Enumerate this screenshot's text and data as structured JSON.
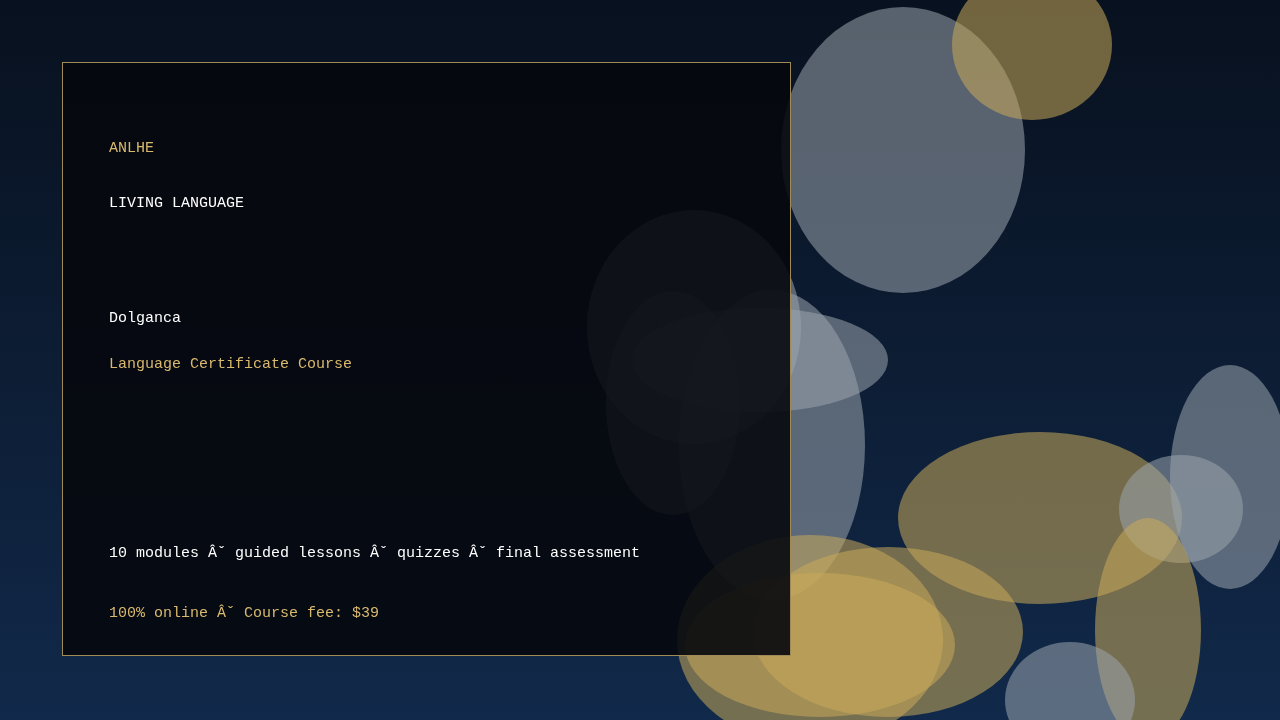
{
  "brand": "ANLHE",
  "title": "LIVING LANGUAGE",
  "language": "Dolganca",
  "course": "Language Certificate Course",
  "features": "10 modules Âˇ guided lessons Âˇ quizzes Âˇ final assessment",
  "pricing": "100% online Âˇ Course fee: $39"
}
